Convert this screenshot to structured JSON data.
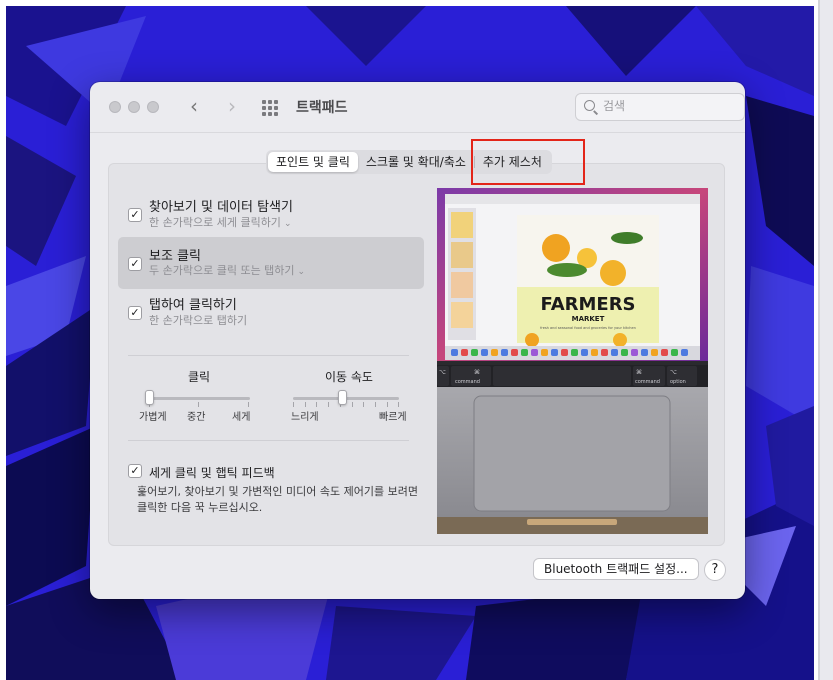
{
  "window": {
    "title": "트랙패드",
    "search": {
      "placeholder": "검색"
    }
  },
  "tabs": [
    {
      "label": "포인트 및 클릭",
      "active": true
    },
    {
      "label": "스크롤 및 확대/축소",
      "active": false
    },
    {
      "label": "추가 제스처",
      "active": false
    }
  ],
  "options": [
    {
      "title": "찾아보기 및 데이터 탐색기",
      "subtitle": "한 손가락으로 세게 클릭하기",
      "checked": true,
      "has_dropdown": true
    },
    {
      "title": "보조 클릭",
      "subtitle": "두 손가락으로 클릭 또는 탭하기",
      "checked": true,
      "has_dropdown": true,
      "selected": true
    },
    {
      "title": "탭하여 클릭하기",
      "subtitle": "한 손가락으로 탭하기",
      "checked": true,
      "has_dropdown": false
    }
  ],
  "sliders": {
    "click": {
      "title": "클릭",
      "labels": [
        "가볍게",
        "중간",
        "세게"
      ],
      "value_index": 0,
      "steps": 3
    },
    "tracking": {
      "title": "이동 속도",
      "labels": [
        "느리게",
        "빠르게"
      ],
      "value_fraction": 0.4,
      "ticks": 10
    }
  },
  "force_click": {
    "title": "세게 클릭 및 햅틱 피드백",
    "checked": true,
    "description": "훑어보기, 찾아보기 및 가변적인 미디어 속도 제어기를 보려면 클릭한 다음 꾹 누르십시오."
  },
  "preview": {
    "poster_title": "FARMERS",
    "poster_subtitle": "MARKET",
    "poster_tagline": "fresh and seasonal food and groceries for your kitchen",
    "keys": {
      "option_glyph": "⌥",
      "command_glyph": "⌘",
      "command_label": "command",
      "option_label": "option"
    }
  },
  "buttons": {
    "bluetooth": "Bluetooth 트랙패드 설정...",
    "help": "?"
  },
  "colors": {
    "desktop": "#2a1fd6",
    "highlight": "#e32519",
    "poster_bg": "#eef0b0"
  },
  "icons": {
    "back": "chevron-left-icon",
    "forward": "chevron-right-icon",
    "grid": "grid-icon",
    "search": "search-icon",
    "checkmark": "checkmark-icon"
  }
}
